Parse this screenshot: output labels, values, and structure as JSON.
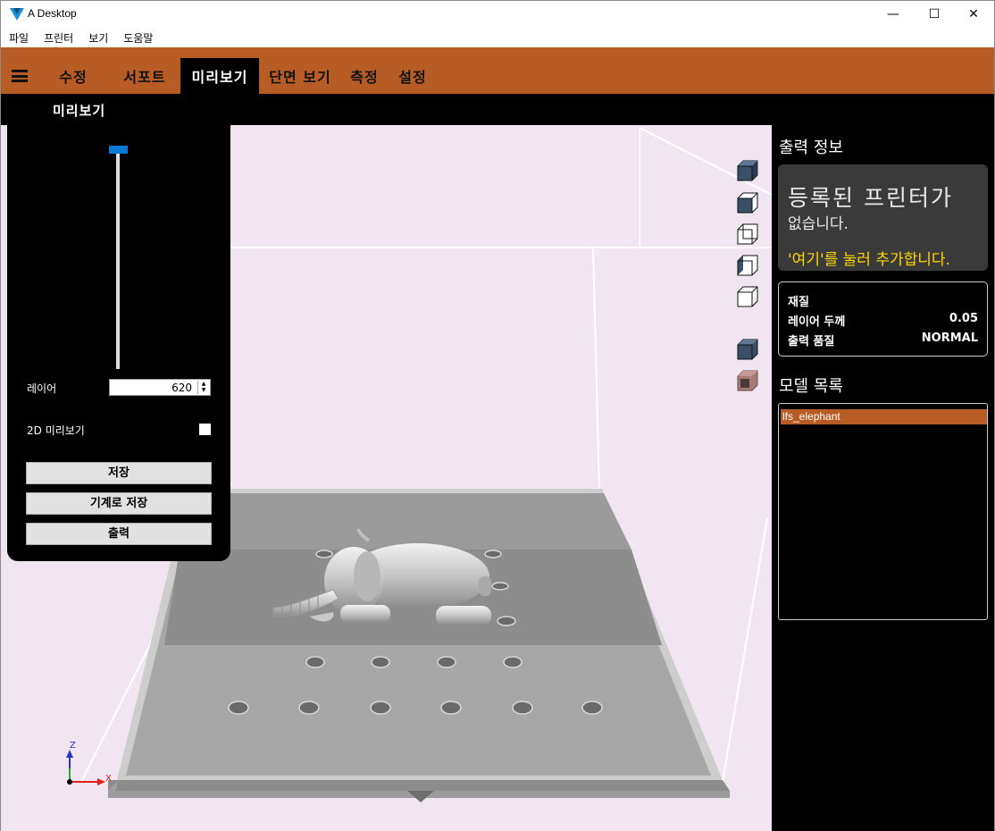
{
  "window": {
    "title": "A Desktop",
    "minimize": "—",
    "maximize": "☐",
    "close": "✕"
  },
  "menu": {
    "items": [
      "파일",
      "프린터",
      "보기",
      "도움말"
    ]
  },
  "tabs": [
    "수정",
    "서포트",
    "미리보기",
    "단면 보기",
    "측정",
    "설정"
  ],
  "active_tab": "미리보기",
  "subbar": {
    "label": "미리보기"
  },
  "left_panel": {
    "layer_label": "레이어",
    "layer_value": "620",
    "preview2d_label": "2D 미리보기",
    "preview2d_checked": false,
    "save_label": "저장",
    "save_machine_label": "기계로 저장",
    "print_label": "출력"
  },
  "right_panel": {
    "print_info_title": "출력 정보",
    "no_printer_line1": "등록된 프린터가",
    "no_printer_line2": "없습니다.",
    "add_printer_link": "'여기'를 눌러 추가합니다.",
    "material_label": "재질",
    "layer_thickness_label": "레이어 두께",
    "layer_thickness_value": "0.05",
    "print_quality_label": "출력 품질",
    "print_quality_value": "NORMAL",
    "model_list_title": "모델 목록",
    "models": [
      "lfs_elephant"
    ]
  },
  "axes": {
    "z": "Z",
    "x": "X"
  },
  "colors": {
    "accent": "#b85c26",
    "slider_thumb": "#0a78d7",
    "link": "#ffd700"
  }
}
